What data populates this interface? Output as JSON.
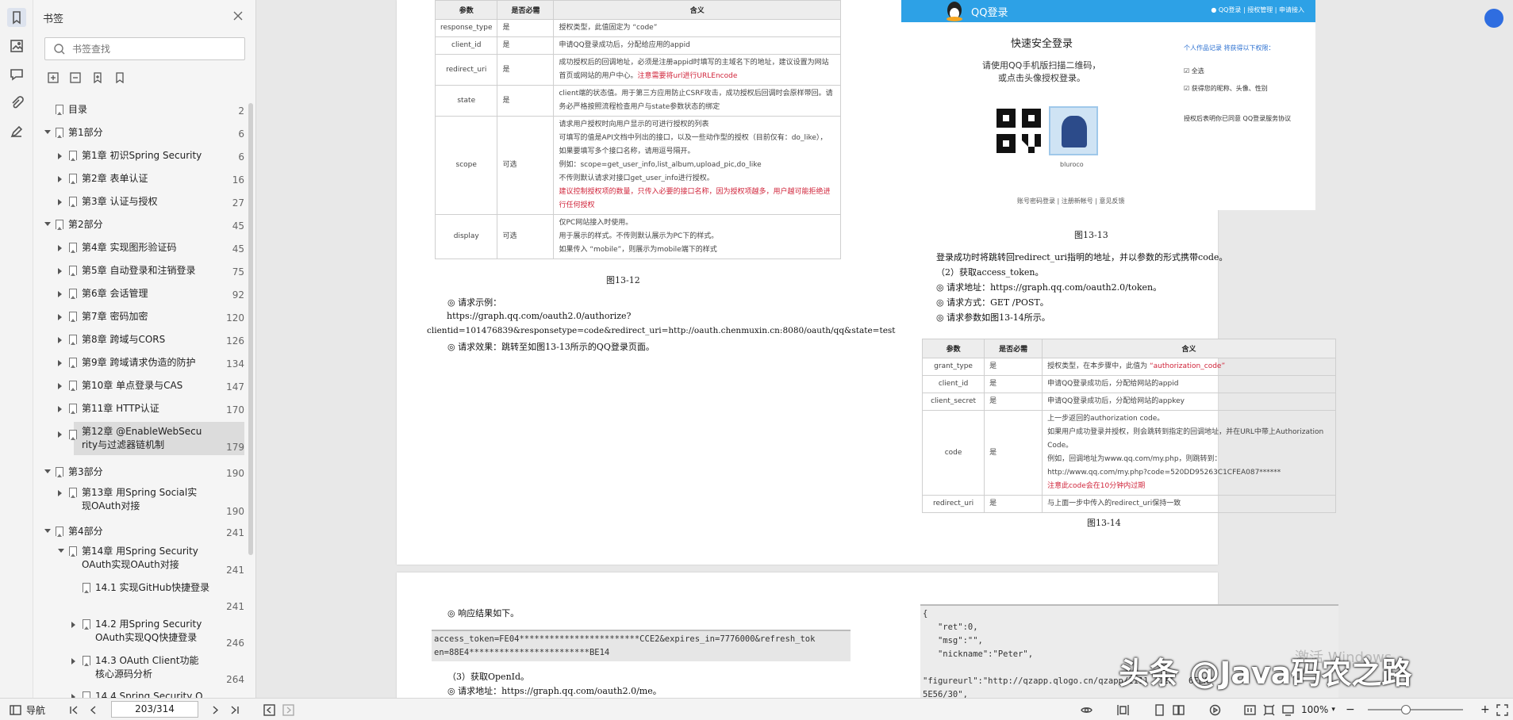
{
  "panel": {
    "title": "书签",
    "search_placeholder": "书签查找"
  },
  "tree": [
    {
      "label": "目录",
      "page": "2"
    },
    {
      "label": "第1部分",
      "page": "6"
    },
    {
      "label": "第1章 初识Spring Security",
      "page": "6"
    },
    {
      "label": "第2章 表单认证",
      "page": "16"
    },
    {
      "label": "第3章 认证与授权",
      "page": "27"
    },
    {
      "label": "第2部分",
      "page": "45"
    },
    {
      "label": "第4章 实现图形验证码",
      "page": "45"
    },
    {
      "label": "第5章 自动登录和注销登录",
      "page": "75"
    },
    {
      "label": "第6章 会话管理",
      "page": "92"
    },
    {
      "label": "第7章 密码加密",
      "page": "120"
    },
    {
      "label": "第8章 跨域与CORS",
      "page": "126"
    },
    {
      "label": "第9章 跨域请求伪造的防护",
      "page": "134"
    },
    {
      "label": "第10章 单点登录与CAS",
      "page": "147"
    },
    {
      "label": "第11章 HTTP认证",
      "page": "170"
    },
    {
      "label": "第12章 @EnableWebSecu",
      "label2": "rity与过滤器链机制",
      "page": "179"
    },
    {
      "label": "第3部分",
      "page": "190"
    },
    {
      "label": "第13章 用Spring Social实",
      "label2": "现OAuth对接",
      "page": "190"
    },
    {
      "label": "第4部分",
      "page": "241"
    },
    {
      "label": "第14章 用Spring Security",
      "label2": "OAuth实现OAuth对接",
      "page": "241"
    },
    {
      "label": "14.1 实现GitHub快捷登录",
      "label2": "",
      "page": "241"
    },
    {
      "label": "14.2 用Spring Security",
      "label2": "OAuth实现QQ快捷登录",
      "page": "246"
    },
    {
      "label": "14.3 OAuth Client功能",
      "label2": "核心源码分析",
      "page": "264"
    },
    {
      "label": "14.4 Spring Security O",
      "page": ""
    }
  ],
  "doc": {
    "table1": {
      "headers": [
        "参数",
        "是否必需",
        "含义"
      ],
      "rows": [
        {
          "p": "response_type",
          "r": "是",
          "m": [
            "授权类型，此值固定为 “code”"
          ]
        },
        {
          "p": "client_id",
          "r": "是",
          "m": [
            "申请QQ登录成功后，分配给应用的appid"
          ]
        },
        {
          "p": "redirect_uri",
          "r": "是",
          "m": [
            "成功授权后的回调地址，必须是注册appid时填写的主域名下的地址，建议设置为网站",
            "首页或网站的用户中心。"
          ],
          "red": "注意需要将url进行URLEncode"
        },
        {
          "p": "state",
          "r": "是",
          "m": [
            "client端的状态值。用于第三方应用防止CSRF攻击，成功授权后回调时会原样带回。请",
            "务必严格按照流程检查用户与state参数状态的绑定"
          ]
        },
        {
          "p": "scope",
          "r": "可选",
          "m": [
            "请求用户授权时向用户显示的可进行授权的列表",
            "可填写的值是API文档中列出的接口，以及一些动作型的授权（目前仅有：do_like），",
            "如果要填写多个接口名称，请用逗号隔开。",
            "例如：scope=get_user_info,list_album,upload_pic,do_like",
            "不传则默认请求对接口get_user_info进行授权。"
          ],
          "red": "建议控制授权项的数量，只传入必要的接口名称，因为授权项越多，用户越可能拒绝进行任何授权"
        },
        {
          "p": "display",
          "r": "可选",
          "m": [
            "仅PC网站接入时使用。",
            "用于展示的样式。不传则默认展示为PC下的样式。",
            "如果传入 “mobile”，则展示为mobile端下的样式"
          ]
        }
      ]
    },
    "cap12": "图13-12",
    "req_example_label": "◎ 请求示例：",
    "req_url1": "https://graph.qq.com/oauth2.0/authorize?",
    "req_url2": "clientid=101476839&responsetype=code&redirect_uri=http://oauth.chenmuxin.cn:8080/oauth/qq&state=test",
    "req_effect": "◎ 请求效果：跳转至如图13-13所示的QQ登录页面。",
    "qq": {
      "title": "QQ登录",
      "links": "● QQ登录 | 授权管理 | 申请接入",
      "heading": "快速安全登录",
      "line1": "请使用QQ手机版扫描二维码，",
      "line2": "或点击头像授权登录。",
      "user": "bluroco",
      "right1": "个人作品记录 将获得以下权限：",
      "right2": "全选",
      "right3": "获得您的昵称、头像、性别",
      "right4": "授权后表明你已同意 QQ登录服务协议",
      "bottom": "账号密码登录 | 注册新帐号 | 意见反馈"
    },
    "cap13": "图13-13",
    "r1": "登录成功时将跳转回redirect_uri指明的地址，并以参数的形式携带code。",
    "r2": "（2）获取access_token。",
    "r3": "◎ 请求地址：https://graph.qq.com/oauth2.0/token。",
    "r4": "◎ 请求方式：GET /POST。",
    "r5": "◎ 请求参数如图13-14所示。",
    "table2": {
      "headers": [
        "参数",
        "是否必需",
        "含义"
      ],
      "rows": [
        {
          "p": "grant_type",
          "r": "是",
          "m": [
            "授权类型，在本步骤中，此值为 "
          ],
          "red": "“authorization_code”"
        },
        {
          "p": "client_id",
          "r": "是",
          "m": [
            "申请QQ登录成功后，分配给网站的appid"
          ]
        },
        {
          "p": "client_secret",
          "r": "是",
          "m": [
            "申请QQ登录成功后，分配给网站的appkey"
          ]
        },
        {
          "p": "code",
          "r": "是",
          "m": [
            "上一步返回的authorization code。",
            "如果用户成功登录并授权，则会跳转到指定的回调地址，并在URL中带上Authorization",
            "Code。",
            "例如，回调地址为www.qq.com/my.php，则跳转到：",
            "http://www.qq.com/my.php?code=520DD95263C1CFEA087******"
          ],
          "red": "注意此code会在10分钟内过期"
        },
        {
          "p": "redirect_uri",
          "r": "是",
          "m": [
            "与上面一步中传入的redirect_uri保持一致"
          ]
        }
      ]
    },
    "cap14": "图13-14",
    "resp_label": "◎ 响应结果如下。",
    "code1a": "access_token=FE04************************CCE2&expires_in=7776000&refresh_tok",
    "code1b": "en=88E4************************BE14",
    "step3": "（3）获取OpenId。",
    "step3_url": "◎ 请求地址：https://graph.qq.com/oauth2.0/me。",
    "code2": [
      "{",
      "   \"ret\":0,",
      "   \"msg\":\"\",",
      "   \"nickname\":\"Peter\",",
      "",
      "\"figureurl\":\"http://qzapp.qlogo.cn/qzapp/1111   2F   6EEA   B",
      "5E56/30\","
    ]
  },
  "status": {
    "nav_label": "导航",
    "page_indicator": "203/314",
    "zoom": "100%",
    "zoom_fraction": 0.4
  },
  "overlay": {
    "watermark": "头条 @Java码农之路",
    "activate": "激活 Windows"
  },
  "colors": {
    "accent": "#2da1e6",
    "red": "#d0243a",
    "selection": "#dcdcdc"
  }
}
